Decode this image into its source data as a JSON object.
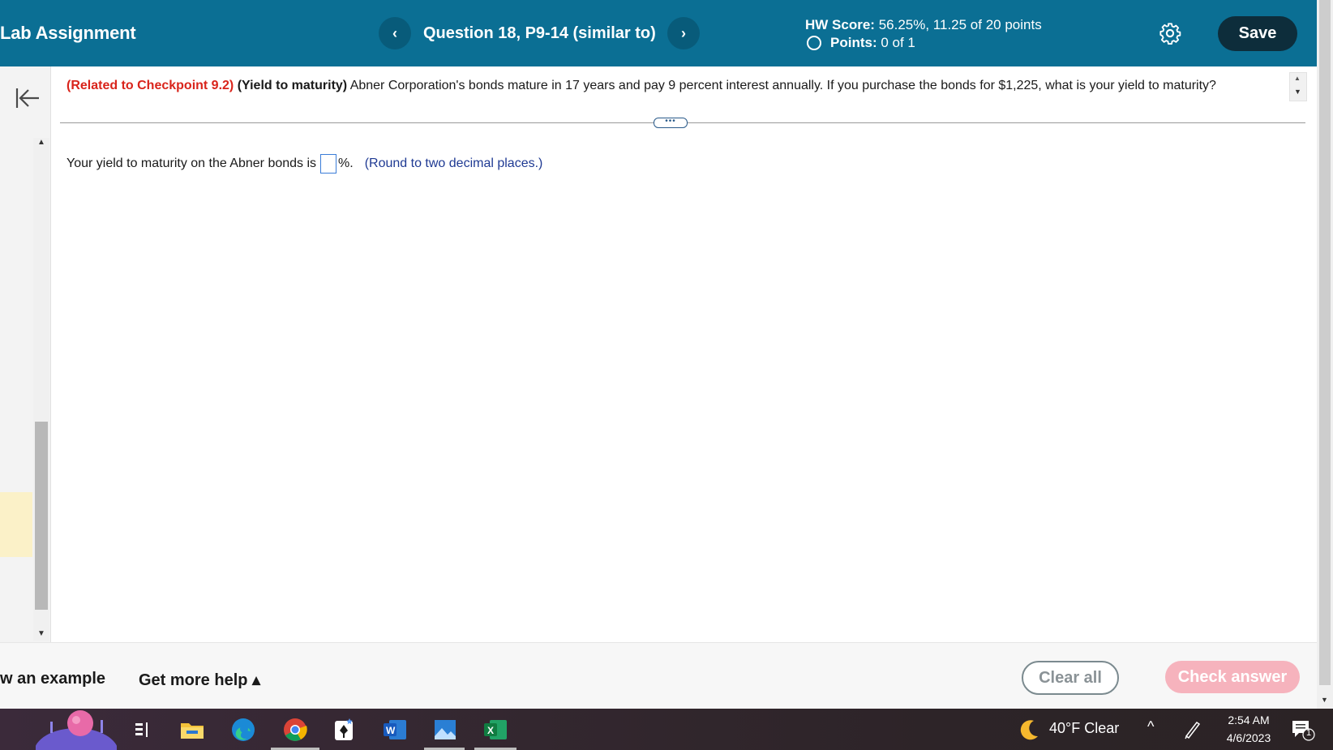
{
  "header": {
    "app_title": "Lab Assignment",
    "prev_label": "‹",
    "next_label": "›",
    "question_title": "Question 18, P9-14 (similar to)",
    "hw_score_label": "HW Score:",
    "hw_score_value": "56.25%, 11.25 of 20 points",
    "points_label": "Points:",
    "points_value": "0 of 1",
    "save_label": "Save",
    "settings_icon": "gear-icon",
    "colors": {
      "bar": "#0b6f94",
      "save": "#0d2d3b"
    }
  },
  "question": {
    "related": "(Related to Checkpoint 9.2)",
    "topic": "(Yield to maturity)",
    "text": "Abner Corporation's bonds mature in 17 years and pay 9 percent interest annually.  If you purchase the bonds for $1,225, what is your yield to maturity?",
    "expand_label": "•••"
  },
  "answer": {
    "prefix": "Your yield to maturity on the Abner bonds is",
    "input_value": "",
    "suffix": "%.",
    "hint": "(Round to two decimal places.)"
  },
  "footer": {
    "example_label": "w an example",
    "more_help_label": "Get more help ▴",
    "clear_label": "Clear all",
    "check_label": "Check answer",
    "colors": {
      "check": "#f6b3bd"
    }
  },
  "taskbar": {
    "weather": "40°F  Clear",
    "time": "2:54 AM",
    "date": "4/6/2023",
    "notification_count": "1",
    "apps": [
      "task-view-icon",
      "file-explorer-icon",
      "edge-icon",
      "chrome-icon",
      "solitaire-icon",
      "word-icon",
      "photos-icon",
      "excel-icon"
    ]
  }
}
